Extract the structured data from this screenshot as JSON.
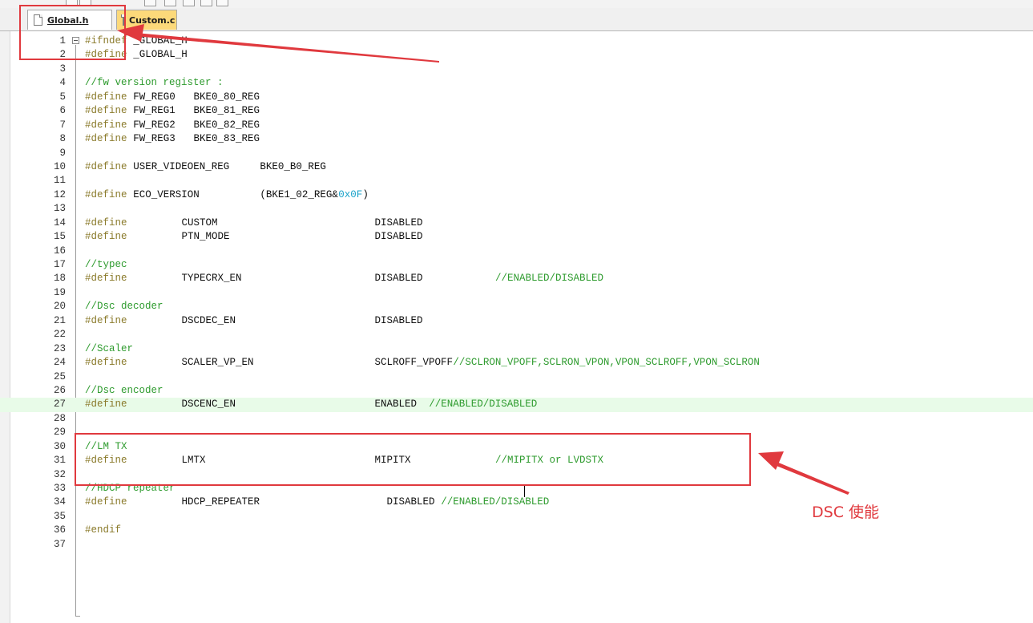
{
  "tabs": [
    {
      "label": "Global.h",
      "active": true
    },
    {
      "label": "Custom.c",
      "active": false
    }
  ],
  "colors": {
    "preprocessor": "#8a7a2a",
    "comment": "#2e9b2e",
    "identifier": "#111111",
    "hex_literal": "#1aa2c9",
    "current_line": "#e8fbe8",
    "annotation": "#e0393e",
    "inactive_tab": "#fcd97a"
  },
  "editor": {
    "current_line": 27,
    "lines": [
      {
        "n": "1",
        "tokens": [
          {
            "t": "#ifndef",
            "c": "pre",
            "x": 0
          },
          {
            "t": "_GLOBAL_H",
            "c": "id",
            "x": 8
          }
        ]
      },
      {
        "n": "2",
        "tokens": [
          {
            "t": "#define",
            "c": "pre",
            "x": 0
          },
          {
            "t": "_GLOBAL_H",
            "c": "id",
            "x": 8
          }
        ]
      },
      {
        "n": "3",
        "tokens": []
      },
      {
        "n": "4",
        "tokens": [
          {
            "t": "//fw version register :",
            "c": "com",
            "x": 0
          }
        ]
      },
      {
        "n": "5",
        "tokens": [
          {
            "t": "#define",
            "c": "pre",
            "x": 0
          },
          {
            "t": "FW_REG0",
            "c": "id",
            "x": 8
          },
          {
            "t": "BKE0_80_REG",
            "c": "id",
            "x": 18
          }
        ]
      },
      {
        "n": "6",
        "tokens": [
          {
            "t": "#define",
            "c": "pre",
            "x": 0
          },
          {
            "t": "FW_REG1",
            "c": "id",
            "x": 8
          },
          {
            "t": "BKE0_81_REG",
            "c": "id",
            "x": 18
          }
        ]
      },
      {
        "n": "7",
        "tokens": [
          {
            "t": "#define",
            "c": "pre",
            "x": 0
          },
          {
            "t": "FW_REG2",
            "c": "id",
            "x": 8
          },
          {
            "t": "BKE0_82_REG",
            "c": "id",
            "x": 18
          }
        ]
      },
      {
        "n": "8",
        "tokens": [
          {
            "t": "#define",
            "c": "pre",
            "x": 0
          },
          {
            "t": "FW_REG3",
            "c": "id",
            "x": 8
          },
          {
            "t": "BKE0_83_REG",
            "c": "id",
            "x": 18
          }
        ]
      },
      {
        "n": "9",
        "tokens": []
      },
      {
        "n": "10",
        "tokens": [
          {
            "t": "#define",
            "c": "pre",
            "x": 0
          },
          {
            "t": "USER_VIDEOEN_REG",
            "c": "id",
            "x": 8
          },
          {
            "t": "BKE0_B0_REG",
            "c": "id",
            "x": 29
          }
        ]
      },
      {
        "n": "11",
        "tokens": []
      },
      {
        "n": "12",
        "tokens": [
          {
            "t": "#define",
            "c": "pre",
            "x": 0
          },
          {
            "t": "ECO_VERSION",
            "c": "id",
            "x": 8
          },
          {
            "t": "(BKE1_02_REG&",
            "c": "id",
            "x": 29
          },
          {
            "t": "0x0F",
            "c": "hex",
            "x": 42
          },
          {
            "t": ")",
            "c": "id",
            "x": 46
          }
        ]
      },
      {
        "n": "13",
        "tokens": []
      },
      {
        "n": "14",
        "tokens": [
          {
            "t": "#define",
            "c": "pre",
            "x": 0
          },
          {
            "t": "CUSTOM",
            "c": "id",
            "x": 16
          },
          {
            "t": "DISABLED",
            "c": "id",
            "x": 48
          }
        ]
      },
      {
        "n": "15",
        "tokens": [
          {
            "t": "#define",
            "c": "pre",
            "x": 0
          },
          {
            "t": "PTN_MODE",
            "c": "id",
            "x": 16
          },
          {
            "t": "DISABLED",
            "c": "id",
            "x": 48
          }
        ]
      },
      {
        "n": "16",
        "tokens": []
      },
      {
        "n": "17",
        "tokens": [
          {
            "t": "//typec",
            "c": "com",
            "x": 0
          }
        ]
      },
      {
        "n": "18",
        "tokens": [
          {
            "t": "#define",
            "c": "pre",
            "x": 0
          },
          {
            "t": "TYPECRX_EN",
            "c": "id",
            "x": 16
          },
          {
            "t": "DISABLED",
            "c": "id",
            "x": 48
          },
          {
            "t": "//ENABLED/DISABLED",
            "c": "com",
            "x": 68
          }
        ]
      },
      {
        "n": "19",
        "tokens": []
      },
      {
        "n": "20",
        "tokens": [
          {
            "t": "//Dsc decoder",
            "c": "com",
            "x": 0
          }
        ]
      },
      {
        "n": "21",
        "tokens": [
          {
            "t": "#define",
            "c": "pre",
            "x": 0
          },
          {
            "t": "DSCDEC_EN",
            "c": "id",
            "x": 16
          },
          {
            "t": "DISABLED",
            "c": "id",
            "x": 48
          }
        ]
      },
      {
        "n": "22",
        "tokens": []
      },
      {
        "n": "23",
        "tokens": [
          {
            "t": "//Scaler",
            "c": "com",
            "x": 0
          }
        ]
      },
      {
        "n": "24",
        "tokens": [
          {
            "t": "#define",
            "c": "pre",
            "x": 0
          },
          {
            "t": "SCALER_VP_EN",
            "c": "id",
            "x": 16
          },
          {
            "t": "SCLROFF_VPOFF",
            "c": "id",
            "x": 48
          },
          {
            "t": "//SCLRON_VPOFF,SCLRON_VPON,VPON_SCLROFF,VPON_SCLRON",
            "c": "com",
            "x": 61
          }
        ]
      },
      {
        "n": "25",
        "tokens": []
      },
      {
        "n": "26",
        "tokens": [
          {
            "t": "//Dsc encoder",
            "c": "com",
            "x": 0
          }
        ]
      },
      {
        "n": "27",
        "tokens": [
          {
            "t": "#define",
            "c": "pre",
            "x": 0
          },
          {
            "t": "DSCENC_EN",
            "c": "id",
            "x": 16
          },
          {
            "t": "ENABLED",
            "c": "id",
            "x": 48
          },
          {
            "t": "//ENABLED/DISABLED",
            "c": "com",
            "x": 57
          }
        ]
      },
      {
        "n": "28",
        "tokens": []
      },
      {
        "n": "29",
        "tokens": []
      },
      {
        "n": "30",
        "tokens": [
          {
            "t": "//LM TX",
            "c": "com",
            "x": 0
          }
        ]
      },
      {
        "n": "31",
        "tokens": [
          {
            "t": "#define",
            "c": "pre",
            "x": 0
          },
          {
            "t": "LMTX",
            "c": "id",
            "x": 16
          },
          {
            "t": "MIPITX",
            "c": "id",
            "x": 48
          },
          {
            "t": "//MIPITX or LVDSTX",
            "c": "com",
            "x": 68
          }
        ]
      },
      {
        "n": "32",
        "tokens": []
      },
      {
        "n": "33",
        "tokens": [
          {
            "t": "//HDCP repeater",
            "c": "com",
            "x": 0
          }
        ]
      },
      {
        "n": "34",
        "tokens": [
          {
            "t": "#define",
            "c": "pre",
            "x": 0
          },
          {
            "t": "HDCP_REPEATER",
            "c": "id",
            "x": 16
          },
          {
            "t": "DISABLED",
            "c": "id",
            "x": 50
          },
          {
            "t": "//ENABLED/DISABLED",
            "c": "com",
            "x": 59
          }
        ]
      },
      {
        "n": "35",
        "tokens": []
      },
      {
        "n": "36",
        "tokens": [
          {
            "t": "#endif",
            "c": "pre",
            "x": 0
          }
        ]
      },
      {
        "n": "37",
        "tokens": []
      }
    ]
  },
  "annotation": {
    "label": "DSC 使能",
    "icons": [
      "fold-minus-icon",
      "file-icon"
    ]
  }
}
